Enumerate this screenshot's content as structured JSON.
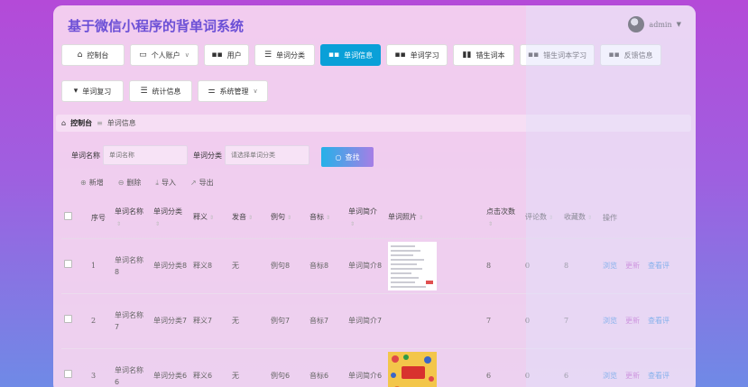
{
  "app": {
    "title": "基于微信小程序的背单词系统",
    "user": "admin"
  },
  "nav": [
    {
      "label": "控制台",
      "icon": "home-icon"
    },
    {
      "label": "个人账户",
      "icon": "wallet-icon",
      "dropdown": true
    },
    {
      "label": "用户",
      "icon": "grid-icon"
    },
    {
      "label": "单词分类",
      "icon": "list-icon"
    },
    {
      "label": "单词信息",
      "icon": "grid-icon",
      "active": true
    },
    {
      "label": "单词学习",
      "icon": "grid-icon"
    },
    {
      "label": "错生词本",
      "icon": "bar-chart-icon"
    },
    {
      "label": "错生词本学习",
      "icon": "grid-icon"
    },
    {
      "label": "反馈信息",
      "icon": "grid-icon"
    },
    {
      "label": "单词复习",
      "icon": "pin-icon"
    },
    {
      "label": "统计信息",
      "icon": "list-icon"
    },
    {
      "label": "系统管理",
      "icon": "sliders-icon",
      "dropdown": true
    }
  ],
  "breadcrumb": {
    "home": "控制台",
    "current": "单词信息"
  },
  "search": {
    "name_label": "单词名称",
    "name_placeholder": "单词名称",
    "category_label": "单词分类",
    "category_placeholder": "请选择单词分类",
    "button": "查找"
  },
  "actions": {
    "add": "新增",
    "delete": "删除",
    "import": "导入",
    "export": "导出"
  },
  "table": {
    "headers": {
      "index": "序号",
      "name": "单词名称",
      "category": "单词分类",
      "meaning": "释义",
      "pronunciation": "发音",
      "example": "例句",
      "phonetic": "音标",
      "intro": "单词简介",
      "photo": "单词照片",
      "clicks": "点击次数",
      "comments": "评论数",
      "favorites": "收藏数",
      "operation": "操作"
    },
    "ops": {
      "view": "浏览",
      "edit": "更新",
      "more": "查看评"
    },
    "rows": [
      {
        "index": "1",
        "name": "单词名称8",
        "category": "单词分类8",
        "meaning": "释义8",
        "pronunciation": "无",
        "example": "例句8",
        "phonetic": "音标8",
        "intro": "单词简介8",
        "photo": "text",
        "clicks": "8",
        "comments": "0",
        "favorites": "8"
      },
      {
        "index": "2",
        "name": "单词名称7",
        "category": "单词分类7",
        "meaning": "释义7",
        "pronunciation": "无",
        "example": "例句7",
        "phonetic": "音标7",
        "intro": "单词简介7",
        "photo": "none",
        "clicks": "7",
        "comments": "0",
        "favorites": "7"
      },
      {
        "index": "3",
        "name": "单词名称6",
        "category": "单词分类6",
        "meaning": "释义6",
        "pronunciation": "无",
        "example": "例句6",
        "phonetic": "音标6",
        "intro": "单词简介6",
        "photo": "book",
        "clicks": "6",
        "comments": "0",
        "favorites": "6"
      }
    ]
  },
  "colors": {
    "accent": "#0aa0d8",
    "title": "#6b4fd6",
    "view_link": "#3c8ce0",
    "edit_link": "#c05ac8"
  }
}
